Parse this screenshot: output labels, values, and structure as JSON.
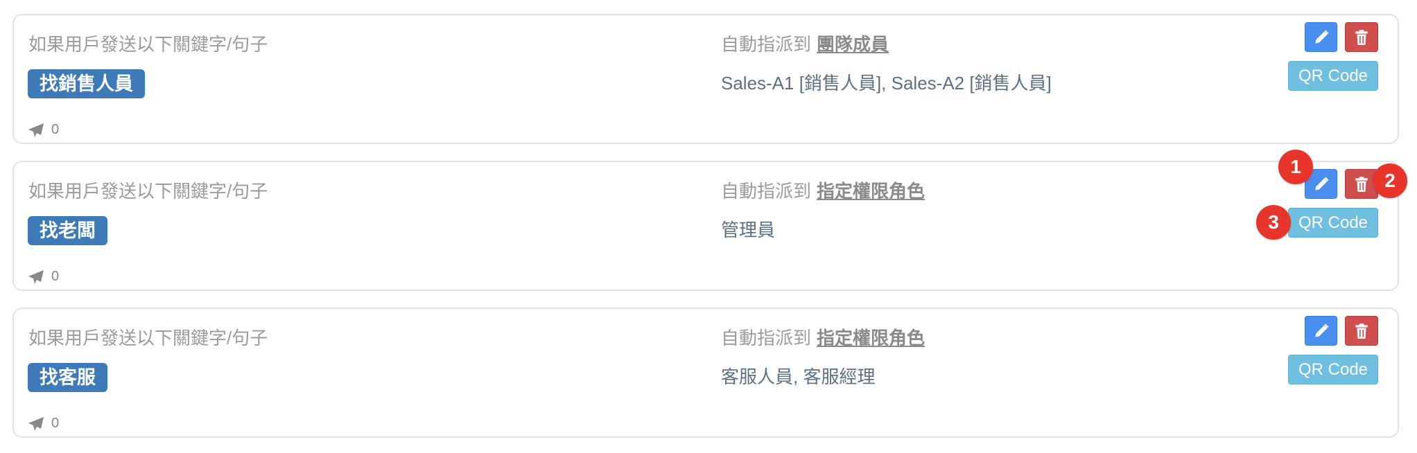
{
  "rules": [
    {
      "condition_label": "如果用戶發送以下關鍵字/句子",
      "keyword": "找銷售人員",
      "sent_count": "0",
      "assign_prefix": "自動指派到",
      "assign_target": "團隊成員",
      "assignees": "Sales-A1 [銷售人員], Sales-A2 [銷售人員]",
      "qr_label": "QR Code"
    },
    {
      "condition_label": "如果用戶發送以下關鍵字/句子",
      "keyword": "找老闆",
      "sent_count": "0",
      "assign_prefix": "自動指派到",
      "assign_target": "指定權限角色",
      "assignees": "管理員",
      "qr_label": "QR Code"
    },
    {
      "condition_label": "如果用戶發送以下關鍵字/句子",
      "keyword": "找客服",
      "sent_count": "0",
      "assign_prefix": "自動指派到",
      "assign_target": "指定權限角色",
      "assignees": "客服人員, 客服經理",
      "qr_label": "QR Code"
    }
  ],
  "callouts": [
    "1",
    "2",
    "3"
  ],
  "colors": {
    "keyword_badge": "#3e7ab8",
    "edit_button": "#4a8ef0",
    "delete_button": "#cf4f4f",
    "qr_button": "#6fbfe0",
    "callout": "#e8352b"
  },
  "icons": {
    "sent": "paper-plane-icon",
    "edit": "pencil-icon",
    "delete": "trash-icon"
  }
}
